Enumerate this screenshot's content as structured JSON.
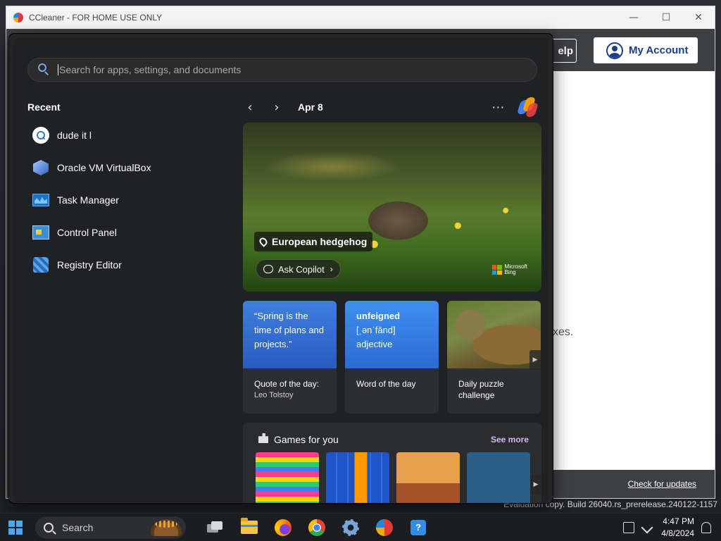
{
  "ccleaner": {
    "title": "CCleaner - FOR HOME USE ONLY",
    "window_buttons": {
      "minimize": "—",
      "maximize": "☐",
      "close": "✕"
    },
    "help_label": "elp",
    "account_label": "My Account",
    "body_text_fragment": "xes.",
    "check_updates": "Check for updates"
  },
  "eval_watermark": "Evaluation copy. Build 26040.rs_prerelease.240122-1157",
  "start_menu": {
    "search": {
      "placeholder": "Search for apps, settings, and documents",
      "value": ""
    },
    "recent_title": "Recent",
    "recent_items": [
      {
        "label": "dude it l",
        "icon": "search-icon"
      },
      {
        "label": "Oracle VM VirtualBox",
        "icon": "virtualbox-icon"
      },
      {
        "label": "Task Manager",
        "icon": "task-manager-icon"
      },
      {
        "label": "Control Panel",
        "icon": "control-panel-icon"
      },
      {
        "label": "Registry Editor",
        "icon": "registry-editor-icon"
      }
    ],
    "widgets": {
      "prev": "‹",
      "next": "›",
      "date": "Apr 8",
      "more": "···",
      "hero": {
        "location": "European hedgehog",
        "ask_copilot": "Ask Copilot",
        "bing_line1": "Microsoft",
        "bing_line2": "Bing"
      },
      "cards": [
        {
          "top": "“Spring is the time of plans and projects.”",
          "title": "Quote of the day:",
          "sub": "Leo Tolstoy"
        },
        {
          "word": "unfeigned",
          "phonetic": "[ˌənˈfānd]",
          "pos": "adjective",
          "title": "Word of the day"
        },
        {
          "title": "Daily puzzle challenge"
        }
      ],
      "games": {
        "title": "Games for you",
        "see_more": "See more"
      }
    }
  },
  "taskbar": {
    "search_label": "Search",
    "clock_time": "4:47 PM",
    "clock_date": "4/8/2024"
  },
  "colors": {
    "accent": "#4aa6ff",
    "start_bg": "#202124",
    "see_more": "#d7b6f5",
    "card_blue": "#3e7fe0",
    "account_text": "#1d3e8a"
  }
}
